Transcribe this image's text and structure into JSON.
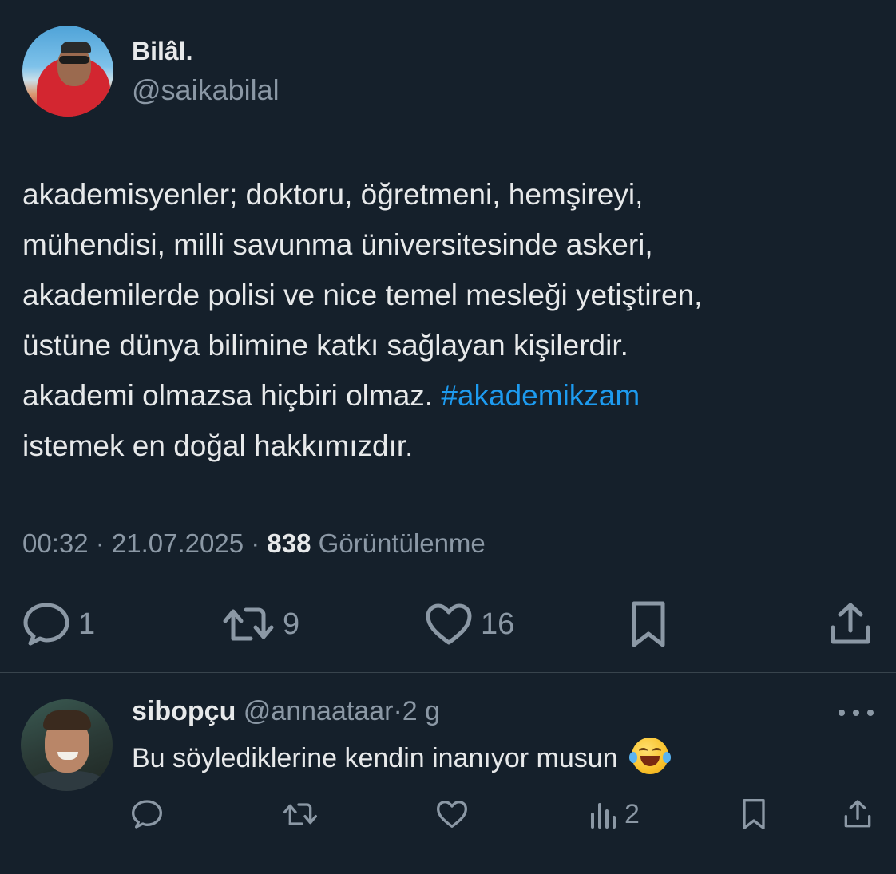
{
  "tweet": {
    "author": {
      "display_name": "Bilâl.",
      "handle": "@saikabilal"
    },
    "text_lines": [
      "akademisyenler; doktoru, öğretmeni, hemşireyi,",
      "mühendisi, milli savunma üniversitesinde askeri,",
      "akademilerde polisi ve nice temel mesleği yetiştiren,",
      "üstüne dünya bilimine katkı sağlayan kişilerdir.",
      "akademi olmazsa hiçbiri olmaz. ",
      "istemek en doğal hakkımızdır."
    ],
    "hashtag": "#akademikzam",
    "meta": {
      "time": "00:32",
      "separator": " · ",
      "date": "21.07.2025",
      "views_count": "838",
      "views_label": " Görüntülenme"
    },
    "actions": {
      "replies": "1",
      "retweets": "9",
      "likes": "16"
    }
  },
  "reply": {
    "display_name": "sibopçu",
    "handle": "@annaataar",
    "dot": "·",
    "time": "2 g",
    "text": "Bu söylediklerine kendin inanıyor musun",
    "emoji": "face-with-tears-of-joy",
    "actions": {
      "views": "2"
    }
  },
  "colors": {
    "background": "#15202b",
    "text": "#e7e9ea",
    "secondary": "#8b98a5",
    "accent": "#1d9bf0",
    "divider": "#38444d"
  }
}
